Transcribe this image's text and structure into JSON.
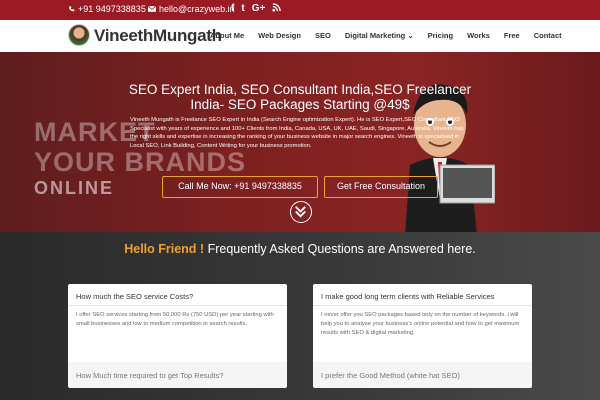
{
  "topbar": {
    "phone": "+91 9497338835",
    "email": "hello@crazyweb.in",
    "social": [
      "f",
      "t",
      "G+",
      "rss"
    ]
  },
  "header": {
    "logo_text": "VineethMungath",
    "nav": [
      "About Me",
      "Web Design",
      "SEO",
      "Digital Marketing",
      "Pricing",
      "Works",
      "Free",
      "Contact"
    ]
  },
  "hero": {
    "title": "SEO Expert India, SEO Consultant India,SEO Freelancer India- SEO Packages Starting @49$",
    "description": "Vineeth Mungath is Freelance SEO Expert in India (Search Engine optimization Expert). He is SEO Expert,SEO Consultant,SEO Specialist with years of experience and 100+ Clients from India, Canada, USA, UK, UAE, Saudi, Singapore, Australia. Vineeth has the right skills and expertise in increasing the ranking of your business website in major search engines. Vineeth is specialised in Local SEO, Link Building, Content Writing for your business promotion.",
    "bg_text": [
      "MARKET",
      "YOUR BRANDS",
      "ONLINE"
    ],
    "btn_call": "Call Me Now: +91 9497338835",
    "btn_consult": "Get Free Consultation"
  },
  "faq": {
    "heading_hi": "Hello Friend !",
    "heading_rest": " Frequently Asked Questions are Answered here.",
    "items": [
      {
        "q": "How much the SEO service Costs?",
        "a": "I offer SEO services starting from 50,000 Rs (750 USD) per year starting with small businesses and low to medium competition in search results."
      },
      {
        "q": "I make good long term clients with Reliable Services",
        "a": "I never offer you SEO packages based only on the number of keywords. i will help you to analyse your business's online potential and how to get maximum results with SEO & digital marketing."
      },
      {
        "q": "How Much time required to get Top Results?",
        "a": ""
      },
      {
        "q": "I prefer the Good Method (white hat SEO)",
        "a": ""
      }
    ]
  },
  "colors": {
    "topbar": "#9b1b25",
    "accent": "#f0a030"
  }
}
